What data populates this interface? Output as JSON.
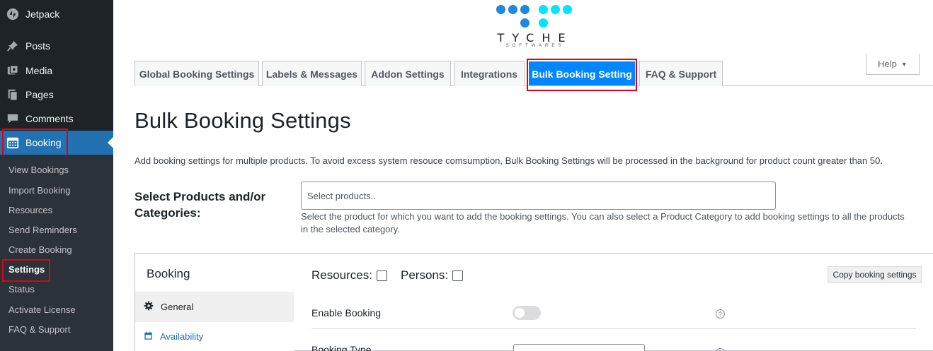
{
  "sidebar": {
    "items": [
      {
        "label": "Jetpack",
        "icon": "jetpack-icon"
      },
      {
        "label": "Posts",
        "icon": "pin-icon"
      },
      {
        "label": "Media",
        "icon": "media-icon"
      },
      {
        "label": "Pages",
        "icon": "pages-icon"
      },
      {
        "label": "Comments",
        "icon": "comment-icon"
      },
      {
        "label": "Booking",
        "icon": "calendar-icon"
      }
    ],
    "submenu": [
      "View Bookings",
      "Import Booking",
      "Resources",
      "Send Reminders",
      "Create Booking",
      "Settings",
      "Status",
      "Activate License",
      "FAQ & Support"
    ]
  },
  "logo": {
    "text": "TYCHE",
    "sub": "SOFTWARES"
  },
  "tabs": [
    "Global Booking Settings",
    "Labels & Messages",
    "Addon Settings",
    "Integrations",
    "Bulk Booking Setting",
    "FAQ & Support"
  ],
  "help": {
    "label": "Help"
  },
  "main": {
    "title": "Bulk Booking Settings",
    "description": "Add booking settings for multiple products. To avoid excess system resouce comsumption, Bulk Booking Settings will be processed in the background for product count greater than 50.",
    "select_label": "Select Products and/or Categories:",
    "select_placeholder": "Select products..",
    "select_help": "Select the product for which you want to add the booking settings. You can also select a Product Category to add booking settings to all the products in the selected category."
  },
  "booking_box": {
    "title": "Booking",
    "resources_label": "Resources:",
    "persons_label": "Persons:",
    "copy_label": "Copy booking settings",
    "nav": [
      "General",
      "Availability"
    ],
    "enable_label": "Enable Booking",
    "type_label": "Booking Type"
  },
  "colors": {
    "sidebar": "#1d2327",
    "submenu": "#2c3338",
    "active": "#2271b1",
    "tab_current": "#0087ff",
    "highlight": "#e1001a"
  }
}
